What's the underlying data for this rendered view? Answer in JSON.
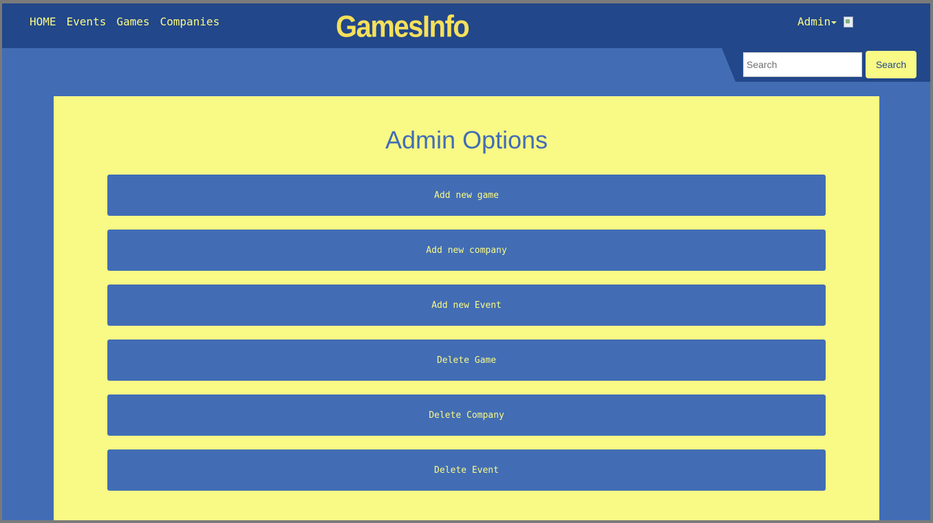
{
  "nav": {
    "links": [
      {
        "label": "HOME"
      },
      {
        "label": "Events"
      },
      {
        "label": "Games"
      },
      {
        "label": "Companies"
      }
    ],
    "logo_text": "GamesInfo",
    "admin_label": "Admin",
    "icons": {
      "caret": "caret-down-icon",
      "avatar": "broken-image-icon"
    }
  },
  "search": {
    "placeholder": "Search",
    "value": "",
    "button_label": "Search"
  },
  "main": {
    "title": "Admin Options",
    "options": [
      {
        "label": "Add new game"
      },
      {
        "label": "Add new company"
      },
      {
        "label": "Add new Event"
      },
      {
        "label": "Delete Game"
      },
      {
        "label": "Delete Company"
      },
      {
        "label": "Delete Event"
      }
    ]
  },
  "colors": {
    "navbar": "#22478a",
    "page_background": "#426db4",
    "panel": "#f9f986",
    "accent_text": "#f9f986",
    "logo": "#f6e05a"
  }
}
